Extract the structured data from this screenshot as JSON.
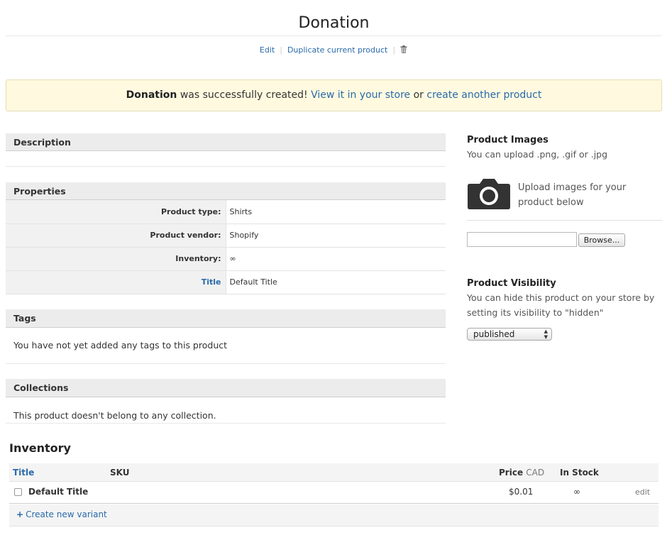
{
  "page": {
    "title": "Donation",
    "actions": {
      "edit": "Edit",
      "duplicate": "Duplicate current product",
      "delete_icon": "trash-icon"
    }
  },
  "flash": {
    "product_name": "Donation",
    "message": " was successfully created! ",
    "view_link": "View it in your store",
    "or": " or ",
    "create_link": "create another product"
  },
  "description": {
    "heading": "Description"
  },
  "properties": {
    "heading": "Properties",
    "rows": [
      {
        "label": "Product type:",
        "value": "Shirts"
      },
      {
        "label": "Product vendor:",
        "value": "Shopify"
      },
      {
        "label": "Inventory:",
        "value": "∞"
      },
      {
        "label": "Title",
        "value": "Default Title"
      }
    ]
  },
  "tags": {
    "heading": "Tags",
    "empty_text": "You have not yet added any tags to this product"
  },
  "collections": {
    "heading": "Collections",
    "empty_text": "This product doesn't belong to any collection."
  },
  "images": {
    "heading": "Product Images",
    "hint": "You can upload .png, .gif or .jpg",
    "upload_note": "Upload images for your product below",
    "browse_label": "Browse...",
    "file_value": "",
    "camera_icon": "camera-icon"
  },
  "visibility": {
    "heading": "Product Visibility",
    "hint": "You can hide this product on your store by setting its visibility to \"hidden\"",
    "selected": "published"
  },
  "inventory": {
    "heading": "Inventory",
    "columns": {
      "title": "Title",
      "sku": "SKU",
      "price": "Price",
      "currency": "CAD",
      "stock": "In Stock"
    },
    "rows": [
      {
        "title": "Default Title",
        "sku": "",
        "price": "$0.01",
        "stock": "∞",
        "action": "edit",
        "checked": false
      }
    ],
    "create_variant": "Create new variant"
  }
}
